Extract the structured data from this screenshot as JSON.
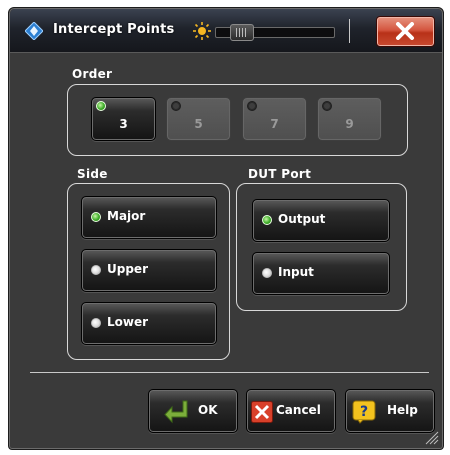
{
  "window": {
    "title": "Intercept Points",
    "icons": {
      "app": "rohde-schwarz-diamond-icon",
      "sun": "sun-icon",
      "close": "close-x-icon"
    },
    "close_color": "#c8432b"
  },
  "order": {
    "label": "Order",
    "options": [
      {
        "label": "3",
        "state": "selected",
        "enabled": true
      },
      {
        "label": "5",
        "state": "unselected",
        "enabled": false
      },
      {
        "label": "7",
        "state": "unselected",
        "enabled": false
      },
      {
        "label": "9",
        "state": "unselected",
        "enabled": false
      }
    ]
  },
  "side": {
    "label": "Side",
    "options": [
      {
        "label": "Major",
        "selected": true
      },
      {
        "label": "Upper",
        "selected": false
      },
      {
        "label": "Lower",
        "selected": false
      }
    ]
  },
  "dut_port": {
    "label": "DUT Port",
    "options": [
      {
        "label": "Output",
        "selected": true
      },
      {
        "label": "Input",
        "selected": false
      }
    ]
  },
  "actions": {
    "ok": {
      "label": "OK",
      "icon": "enter-arrow-icon"
    },
    "cancel": {
      "label": "Cancel",
      "icon": "red-x-icon"
    },
    "help": {
      "label": "Help",
      "icon": "question-mark-icon"
    }
  },
  "colors": {
    "led_on": "#3fae2a",
    "panel_bg": "#3a3a3a",
    "titlebar": "#1f232b"
  }
}
